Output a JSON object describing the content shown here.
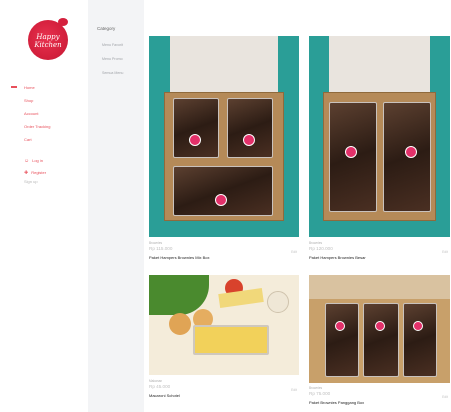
{
  "brand": {
    "logo_text": "Happy Kitchen",
    "accent": "#e8505b"
  },
  "nav": {
    "items": [
      {
        "label": "Home",
        "active": true
      },
      {
        "label": "Shop"
      },
      {
        "label": "Account"
      },
      {
        "label": "Order Tracking"
      },
      {
        "label": "Cart"
      }
    ],
    "login_label": "Log in",
    "register_label": "Register",
    "sub_label": "Sign up"
  },
  "categories": {
    "title": "Category",
    "items": [
      "Menu Favorit",
      "Menu Promo",
      "Semua Menu"
    ]
  },
  "products": [
    {
      "meta": "Brownies",
      "price": "Rp 115.000",
      "name": "Paket Hampers Brownies Mix Box",
      "tag": "Edit",
      "image": "brownie-box-four"
    },
    {
      "meta": "Brownies",
      "price": "Rp 120.000",
      "name": "Paket Hampers Brownies Besar",
      "tag": "Edit",
      "image": "brownie-box-two"
    },
    {
      "meta": "Makanan",
      "price": "Rp 45.000",
      "name": "Macaroni Schotel",
      "tag": "Edit",
      "image": "macaroni-food"
    },
    {
      "meta": "Brownies",
      "price": "Rp 75.000",
      "name": "Paket Brownies Panggang Box",
      "tag": "Edit",
      "image": "brownie-box-three"
    }
  ]
}
